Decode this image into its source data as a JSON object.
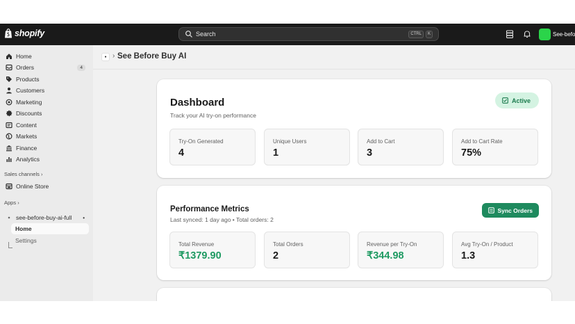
{
  "topbar": {
    "brand": "shopify",
    "search": {
      "placeholder": "Search",
      "shortcut_ctrl": "CTRL",
      "shortcut_key": "K"
    },
    "store_name": "See-before"
  },
  "sidebar": {
    "nav": [
      {
        "label": "Home",
        "icon": "home-icon"
      },
      {
        "label": "Orders",
        "icon": "orders-icon",
        "badge": "4"
      },
      {
        "label": "Products",
        "icon": "tag-icon"
      },
      {
        "label": "Customers",
        "icon": "person-icon"
      },
      {
        "label": "Marketing",
        "icon": "target-icon"
      },
      {
        "label": "Discounts",
        "icon": "discount-icon"
      },
      {
        "label": "Content",
        "icon": "content-icon"
      },
      {
        "label": "Markets",
        "icon": "globe-icon"
      },
      {
        "label": "Finance",
        "icon": "bank-icon"
      },
      {
        "label": "Analytics",
        "icon": "chart-icon"
      }
    ],
    "sales_channels": {
      "label": "Sales channels",
      "chevron": "›",
      "items": [
        {
          "label": "Online Store",
          "icon": "store-icon"
        }
      ]
    },
    "apps": {
      "label": "Apps",
      "chevron": "›",
      "app_name": "see-before-buy-ai-full",
      "app_menu": "•",
      "sub_items": [
        "Home",
        "Settings"
      ]
    }
  },
  "page": {
    "breadcrumb_sep": "›",
    "title": "See Before Buy AI"
  },
  "dashboard": {
    "title": "Dashboard",
    "subtitle": "Track your AI try-on performance",
    "status": "Active",
    "stats": [
      {
        "label": "Try-On Generated",
        "value": "4"
      },
      {
        "label": "Unique Users",
        "value": "1"
      },
      {
        "label": "Add to Cart",
        "value": "3"
      },
      {
        "label": "Add to Cart Rate",
        "value": "75%"
      }
    ]
  },
  "performance": {
    "title": "Performance Metrics",
    "subtitle": "Last synced: 1 day ago • Total orders: 2",
    "sync_label": "Sync Orders",
    "stats": [
      {
        "label": "Total Revenue",
        "value": "₹1379.90"
      },
      {
        "label": "Total Orders",
        "value": "2"
      },
      {
        "label": "Revenue per Try-On",
        "value": "₹344.98"
      },
      {
        "label": "Avg Try-On / Product",
        "value": "1.3"
      }
    ]
  },
  "colors": {
    "accent_green": "#1e8a5e",
    "value_green": "#1e9a62",
    "badge_bg": "#d4f3e2",
    "topbar": "#1a1a1a"
  }
}
